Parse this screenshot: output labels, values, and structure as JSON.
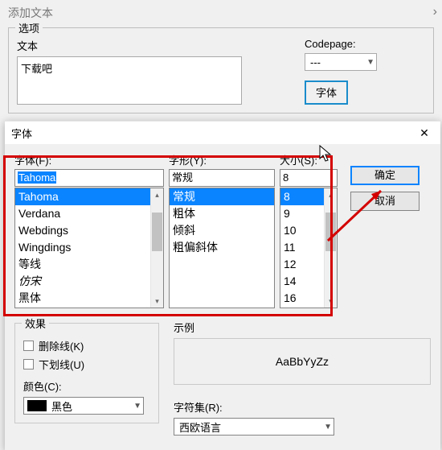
{
  "parent": {
    "title": "添加文本",
    "group": "选项",
    "text_label": "文本",
    "text_value": "下载吧",
    "codepage_label": "Codepage:",
    "codepage_value": "---",
    "font_btn": "字体"
  },
  "dialog": {
    "title": "字体",
    "close": "✕",
    "labels": {
      "font": "字体(F):",
      "style": "字形(Y):",
      "size": "大小(S):"
    },
    "font": {
      "value": "Tahoma",
      "items": [
        "Tahoma",
        "Verdana",
        "Webdings",
        "Wingdings",
        "等线",
        "仿宋",
        "黑体"
      ],
      "selected_index": 0
    },
    "style": {
      "value": "常规",
      "items": [
        "常规",
        "粗体",
        "倾斜",
        "粗偏斜体"
      ],
      "selected_index": 0
    },
    "size": {
      "value": "8",
      "items": [
        "8",
        "9",
        "10",
        "11",
        "12",
        "14",
        "16"
      ],
      "selected_index": 0
    },
    "buttons": {
      "ok": "确定",
      "cancel": "取消"
    },
    "effects": {
      "legend": "效果",
      "strike": "删除线(K)",
      "underline": "下划线(U)",
      "color_label": "颜色(C):",
      "color_name": "黑色"
    },
    "sample": {
      "legend": "示例",
      "text": "AaBbYyZz"
    },
    "script": {
      "label": "字符集(R):",
      "value": "西欧语言"
    }
  }
}
